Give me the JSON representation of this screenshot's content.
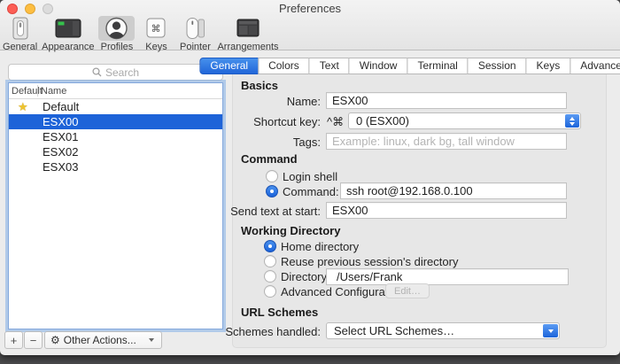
{
  "window": {
    "title": "Preferences"
  },
  "toolbar": {
    "items": [
      {
        "label": "General"
      },
      {
        "label": "Appearance"
      },
      {
        "label": "Profiles"
      },
      {
        "label": "Keys"
      },
      {
        "label": "Pointer"
      },
      {
        "label": "Arrangements"
      }
    ]
  },
  "sidebar": {
    "search_placeholder": "Search",
    "columns": {
      "default": "Default",
      "name": "Name"
    },
    "profiles": [
      {
        "name": "Default"
      },
      {
        "name": "ESX00"
      },
      {
        "name": "ESX01"
      },
      {
        "name": "ESX02"
      },
      {
        "name": "ESX03"
      }
    ],
    "add_label": "+",
    "remove_label": "−",
    "other_actions_label": "Other Actions...",
    "star_icon": "★",
    "gear_icon": "⚙"
  },
  "tabs": [
    {
      "label": "General"
    },
    {
      "label": "Colors"
    },
    {
      "label": "Text"
    },
    {
      "label": "Window"
    },
    {
      "label": "Terminal"
    },
    {
      "label": "Session"
    },
    {
      "label": "Keys"
    },
    {
      "label": "Advanced"
    }
  ],
  "basics": {
    "heading": "Basics",
    "name_label": "Name:",
    "name_value": "ESX00",
    "shortcut_label": "Shortcut key:",
    "shortcut_modifiers": "^⌘",
    "shortcut_value": "0 (ESX00)",
    "tags_label": "Tags:",
    "tags_placeholder": "Example: linux, dark bg, tall window"
  },
  "command": {
    "heading": "Command",
    "login_shell_label": "Login shell",
    "command_label": "Command:",
    "command_value": "ssh root@192.168.0.100",
    "send_text_label": "Send text at start:",
    "send_text_value": "ESX00"
  },
  "working_directory": {
    "heading": "Working Directory",
    "home_label": "Home directory",
    "reuse_label": "Reuse previous session's directory",
    "directory_label": "Directory:",
    "directory_value": "/Users/Frank",
    "advanced_label": "Advanced Configuration",
    "edit_button": "Edit…"
  },
  "url_schemes": {
    "heading": "URL Schemes",
    "label": "Schemes handled:",
    "value": "Select URL Schemes…"
  },
  "colors": {
    "accent": "#2b7ae2",
    "list_selection": "#1d63d8",
    "star": "#edc32e"
  }
}
